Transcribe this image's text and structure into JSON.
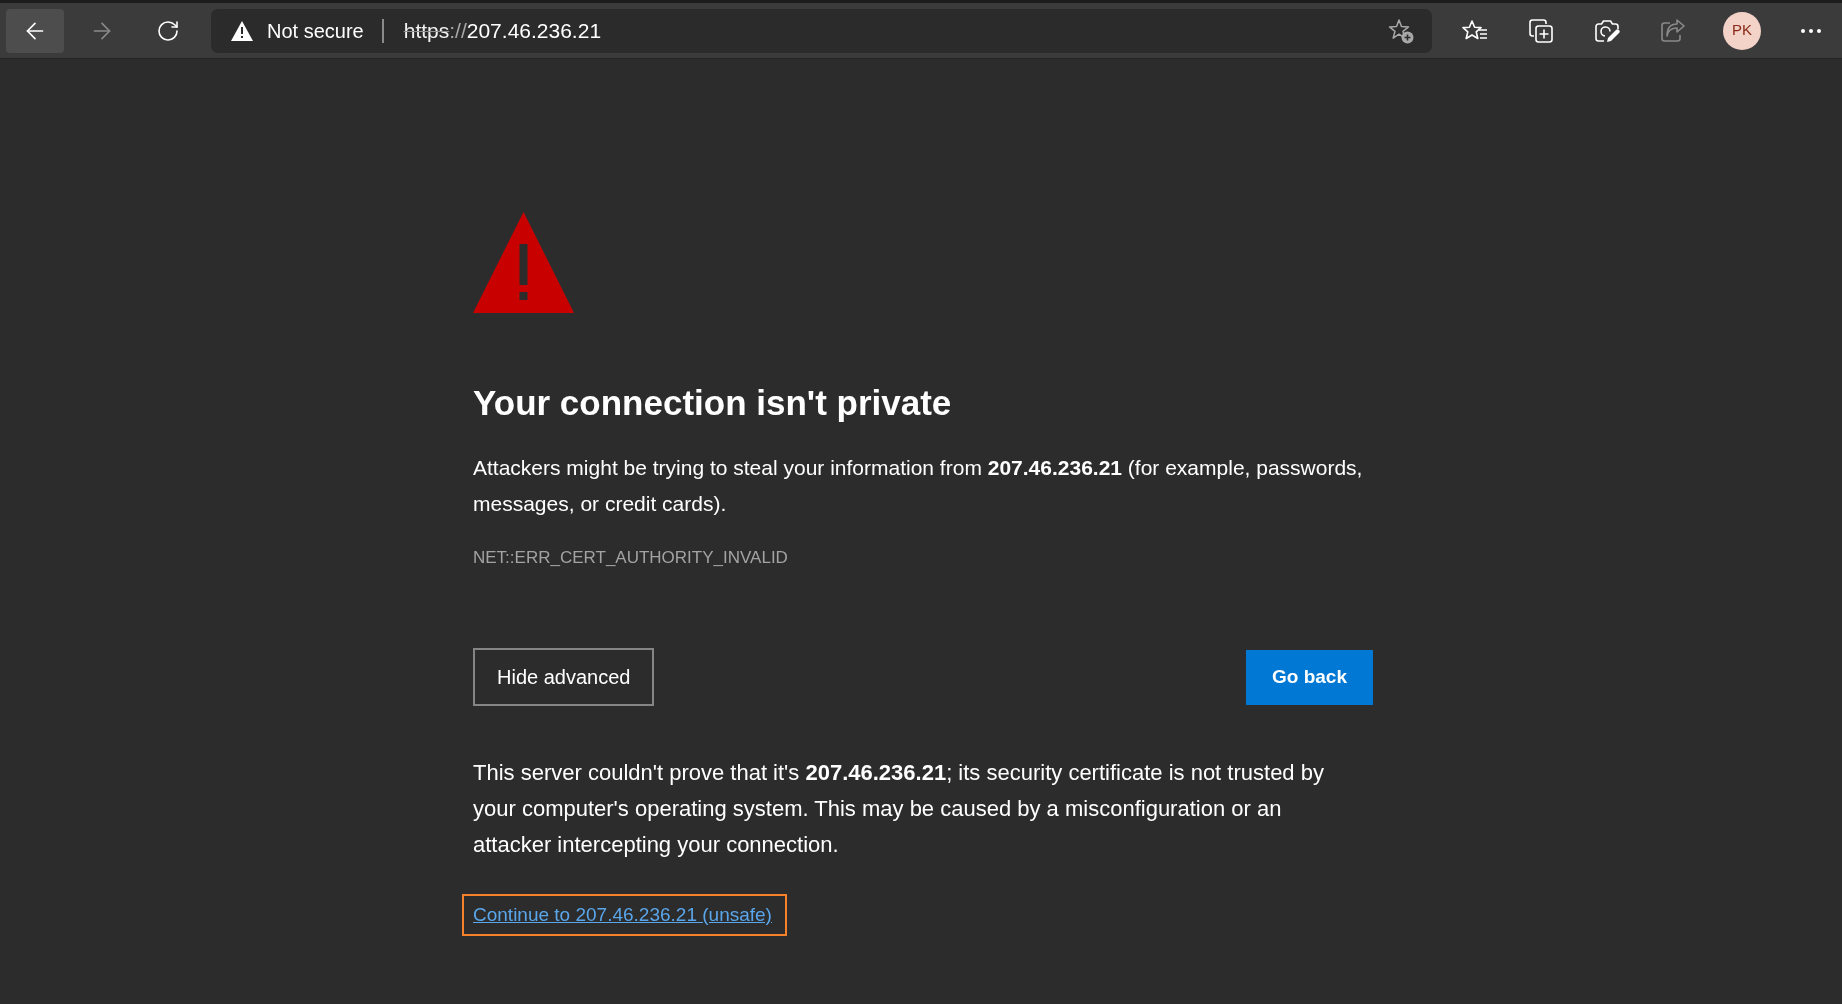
{
  "toolbar": {
    "back": {
      "disabled": false,
      "hovered": true
    },
    "forward": {
      "disabled": true
    },
    "refresh": {
      "disabled": false
    },
    "address_bar": {
      "secure": false,
      "security_label": "Not secure",
      "scheme": "https",
      "separator": "://",
      "host": "207.46.236.21"
    },
    "favorites": {
      "disabled": false
    },
    "collections": {
      "disabled": false
    },
    "web_capture": {
      "disabled": false
    },
    "share": {
      "disabled": true
    },
    "profile": {
      "initials": "PK"
    },
    "more": {
      "disabled": false
    }
  },
  "page": {
    "title": "Your connection isn't private",
    "message": "Attackers might be trying to steal your information from **207.46.236.21** (for example, passwords, messages, or credit cards).",
    "error_code": "NET::ERR_CERT_AUTHORITY_INVALID",
    "buttons": [
      {
        "label": "Hide advanced",
        "kind": "secondary"
      },
      {
        "label": "Go back",
        "kind": "primary"
      }
    ],
    "details": "This server couldn't prove that it's **207.46.236.21**; its security certificate is not trusted by your computer's operating system. This may be caused by a misconfiguration or an attacker intercepting your connection.",
    "proceed_link": {
      "label": "Continue to 207.46.236.21 (unsafe)",
      "highlighted": true
    }
  }
}
